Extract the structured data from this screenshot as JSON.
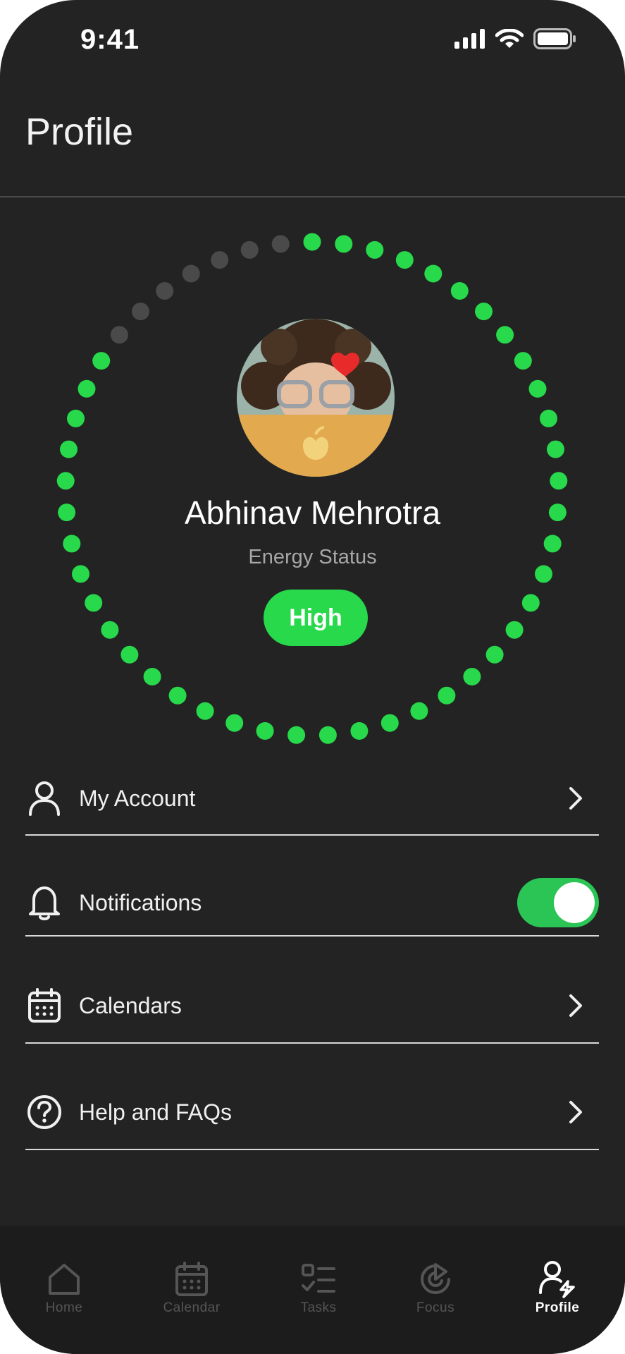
{
  "status_bar": {
    "time": "9:41"
  },
  "header": {
    "title": "Profile"
  },
  "profile": {
    "name": "Abhinav Mehrotra",
    "energy_label": "Energy Status",
    "energy_value": "High",
    "energy_level": 0.86
  },
  "menu": [
    {
      "label": "My Account",
      "icon": "user-icon",
      "control": "chevron"
    },
    {
      "label": "Notifications",
      "icon": "bell-icon",
      "control": "toggle",
      "enabled": true
    },
    {
      "label": "Calendars",
      "icon": "calendar-icon",
      "control": "chevron"
    },
    {
      "label": "Help and FAQs",
      "icon": "help-circle-icon",
      "control": "chevron"
    }
  ],
  "tabs": [
    {
      "label": "Home",
      "icon": "home-icon",
      "active": false
    },
    {
      "label": "Calendar",
      "icon": "calendar-icon",
      "active": false
    },
    {
      "label": "Tasks",
      "icon": "tasks-icon",
      "active": false
    },
    {
      "label": "Focus",
      "icon": "focus-icon",
      "active": false
    },
    {
      "label": "Profile",
      "icon": "profile-bolt-icon",
      "active": true
    }
  ],
  "colors": {
    "background": "#232323",
    "accent_green": "#27d94b",
    "dot_inactive": "#4a4a4a",
    "toggle_green": "#2bc556",
    "tab_bar": "#1c1c1c"
  }
}
